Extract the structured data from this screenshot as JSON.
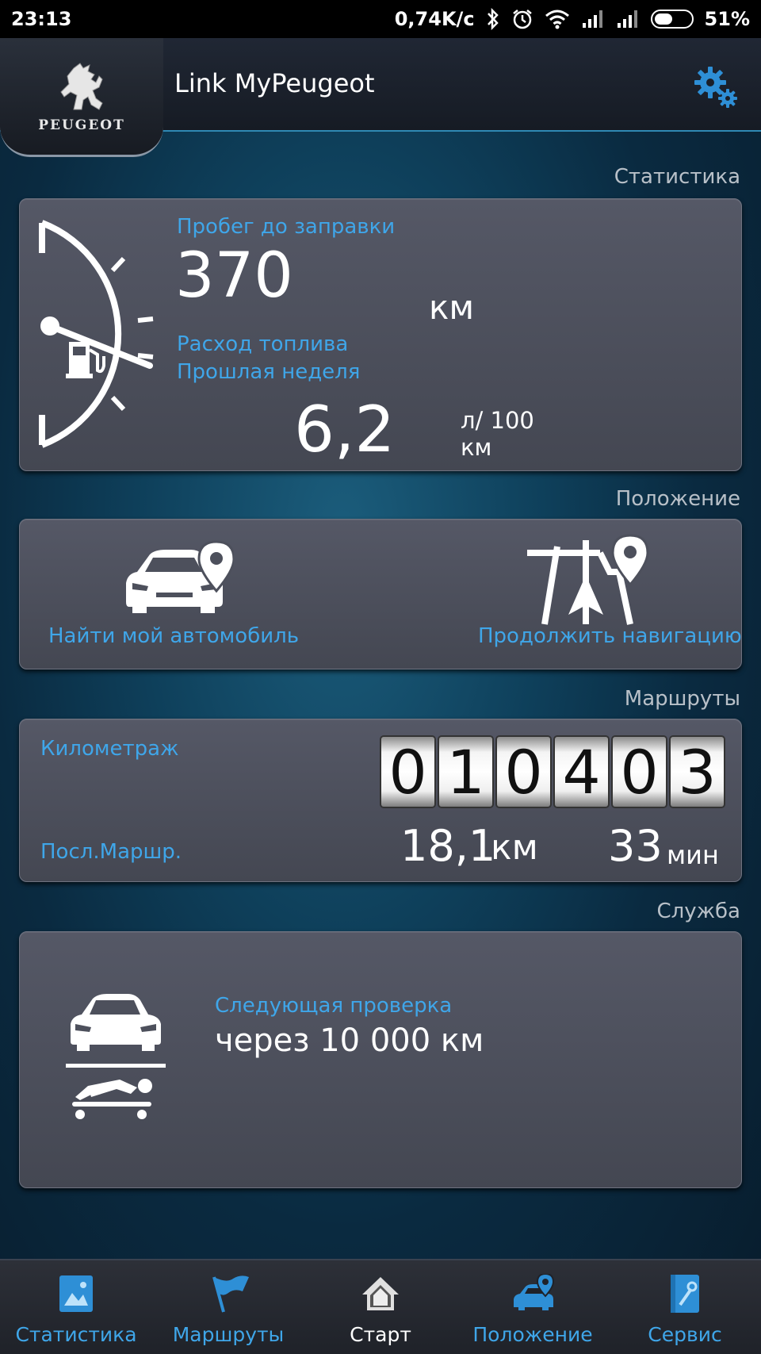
{
  "status_bar": {
    "time": "23:13",
    "speed": "0,74K/c",
    "battery": "51%",
    "battery_level": 0.51
  },
  "header": {
    "logo_text": "PEUGEOT",
    "title": "Link MyPeugeot"
  },
  "statistics": {
    "section_label": "Статистика",
    "range_label": "Пробег до заправки",
    "range_value": "370",
    "range_unit": "км",
    "consumption_label": "Расход топлива",
    "consumption_period": "Прошлая неделя",
    "consumption_value": "6,2",
    "consumption_unit_1": "л/ 100",
    "consumption_unit_2": "км"
  },
  "position": {
    "section_label": "Положение",
    "find_car": "Найти мой автомобиль",
    "continue_nav": "Продолжить навигацию"
  },
  "routes": {
    "section_label": "Маршруты",
    "odometer_label": "Километраж",
    "odometer_digits": [
      "0",
      "1",
      "0",
      "4",
      "0",
      "3"
    ],
    "last_route_label": "Посл.Маршр.",
    "last_distance": "18,1",
    "last_distance_unit": "км",
    "last_duration": "33",
    "last_duration_unit": "мин"
  },
  "service": {
    "section_label": "Служба",
    "next_check_label": "Следующая проверка",
    "next_check_value": "через 10 000 км"
  },
  "nav": {
    "items": [
      {
        "label": "Статистика",
        "icon": "statistics-icon"
      },
      {
        "label": "Маршруты",
        "icon": "flag-icon"
      },
      {
        "label": "Старт",
        "icon": "home-icon"
      },
      {
        "label": "Положение",
        "icon": "car-location-icon"
      },
      {
        "label": "Сервис",
        "icon": "service-book-icon"
      }
    ],
    "active_index": 2
  },
  "colors": {
    "accent": "#3fa6e9",
    "card": "#4d505c",
    "background": "#0e3f5a"
  }
}
